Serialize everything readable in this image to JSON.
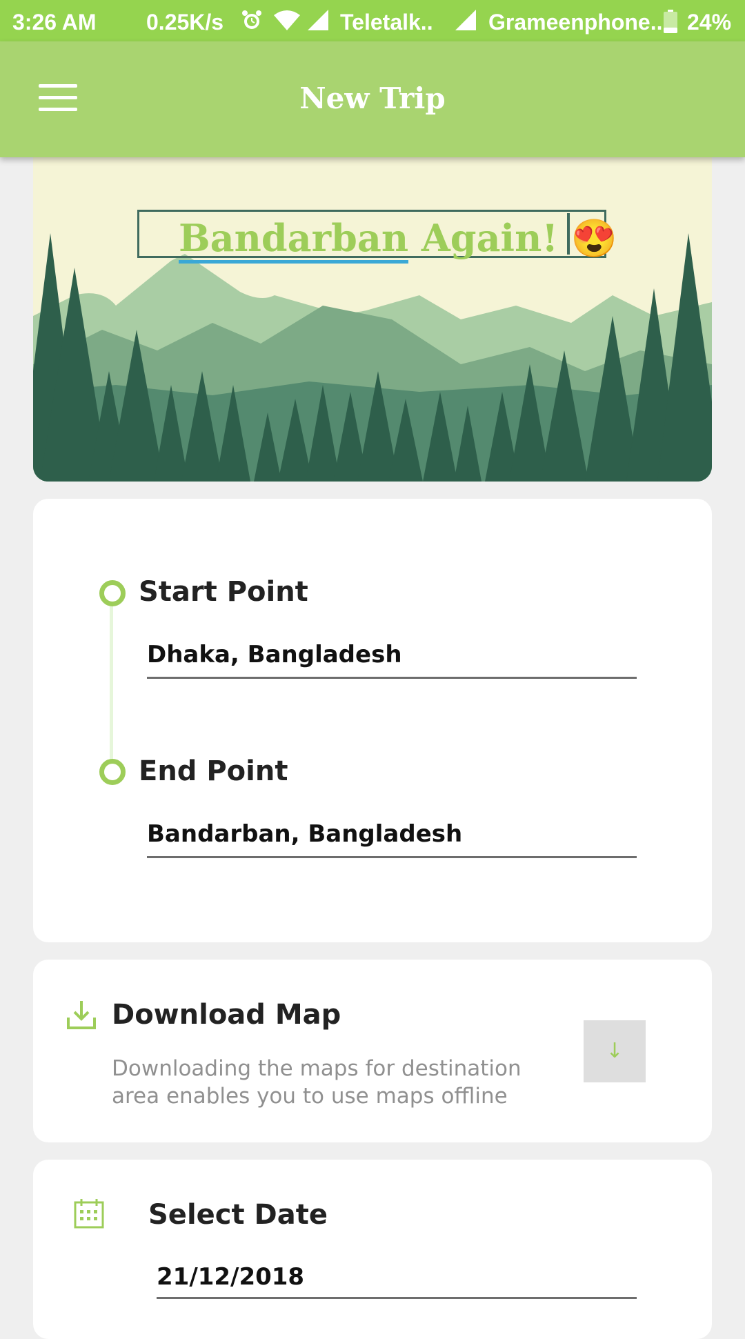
{
  "status_bar": {
    "time": "3:26 AM",
    "speed": "0.25K/s",
    "carrier1": "Teletalk..",
    "carrier2": "Grameenphone..",
    "battery": "24%"
  },
  "app_bar": {
    "title": "New Trip",
    "menu_icon": "hamburger-menu-icon"
  },
  "hero": {
    "trip_name_underlined": "Bandarban",
    "trip_name_rest": " Again!",
    "emoji": "😍",
    "colors": {
      "accent": "#9dcd59",
      "background": "#f5f4d6"
    }
  },
  "route": {
    "start_label": "Start Point",
    "start_value": "Dhaka, Bangladesh",
    "end_label": "End Point",
    "end_value": "Bandarban, Bangladesh"
  },
  "download": {
    "title": "Download Map",
    "description": "Downloading the maps for destination area enables you to use maps offline",
    "button_icon": "↓"
  },
  "date": {
    "title": "Select Date",
    "value": "21/12/2018"
  },
  "colors": {
    "status_bar": "#95d44f",
    "app_bar": "#a9d470",
    "accent": "#9dcd59"
  }
}
